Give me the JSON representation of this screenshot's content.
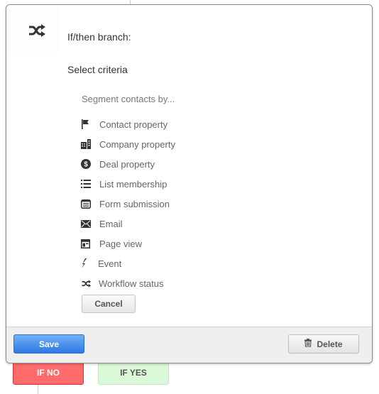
{
  "dialog": {
    "icon": "shuffle-icon",
    "title": "If/then branch:",
    "subtitle": "Select criteria",
    "segment_label": "Segment contacts by...",
    "criteria": [
      {
        "label": "Contact property",
        "icon": "flag-icon"
      },
      {
        "label": "Company property",
        "icon": "building-icon"
      },
      {
        "label": "Deal property",
        "icon": "dollar-circle-icon"
      },
      {
        "label": "List membership",
        "icon": "list-icon"
      },
      {
        "label": "Form submission",
        "icon": "form-icon"
      },
      {
        "label": "Email",
        "icon": "envelope-icon"
      },
      {
        "label": "Page view",
        "icon": "page-layout-icon"
      },
      {
        "label": "Event",
        "icon": "lightning-icon"
      },
      {
        "label": "Workflow status",
        "icon": "shuffle-icon"
      }
    ],
    "cancel_label": "Cancel"
  },
  "footer": {
    "save_label": "Save",
    "delete_label": "Delete",
    "delete_icon": "trash-icon"
  },
  "branches": {
    "no_label": "IF NO",
    "yes_label": "IF YES",
    "colors": {
      "no": "#fd6b6b",
      "yes": "#dbf8d8"
    }
  },
  "colors": {
    "save_button": "#2d78e3",
    "text_primary": "#333333",
    "text_secondary": "#666666"
  }
}
